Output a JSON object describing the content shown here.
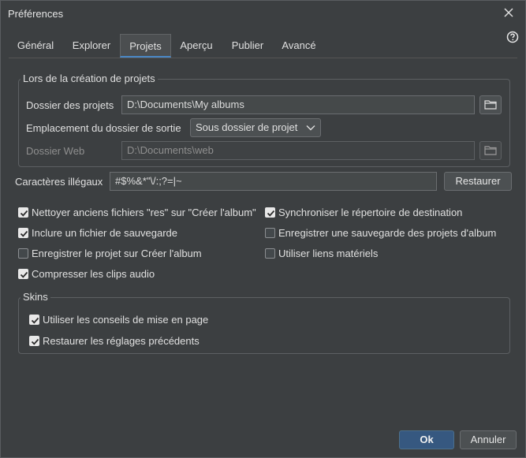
{
  "window": {
    "title": "Préférences"
  },
  "tabs": [
    {
      "label": "Général"
    },
    {
      "label": "Explorer"
    },
    {
      "label": "Projets"
    },
    {
      "label": "Aperçu"
    },
    {
      "label": "Publier"
    },
    {
      "label": "Avancé"
    }
  ],
  "creation": {
    "legend": "Lors de la création de projets",
    "project_folder_label": "Dossier des projets",
    "project_folder_value": "D:\\Documents\\My albums",
    "output_location_label": "Emplacement du dossier de sortie",
    "output_location_value": "Sous dossier de projet",
    "web_folder_label": "Dossier Web",
    "web_folder_value": "D:\\Documents\\web"
  },
  "illegal": {
    "label": "Caractères illégaux",
    "value": "#$%&*\"\\/:;?=|~",
    "restore_label": "Restaurer"
  },
  "options": [
    {
      "label": "Nettoyer anciens fichiers \"res\" sur \"Créer l'album\"",
      "checked": true
    },
    {
      "label": "Synchroniser le répertoire de destination",
      "checked": true
    },
    {
      "label": "Inclure un fichier de sauvegarde",
      "checked": true
    },
    {
      "label": "Enregistrer une sauvegarde des projets d'album",
      "checked": false
    },
    {
      "label": "Enregistrer le projet sur Créer l'album",
      "checked": false
    },
    {
      "label": "Utiliser liens matériels",
      "checked": false
    },
    {
      "label": "Compresser les clips audio",
      "checked": true
    }
  ],
  "skins": {
    "legend": "Skins",
    "options": [
      {
        "label": "Utiliser les conseils de mise en page",
        "checked": true
      },
      {
        "label": "Restaurer les réglages précédents",
        "checked": true
      }
    ]
  },
  "footer": {
    "ok_label": "Ok",
    "cancel_label": "Annuler"
  },
  "colors": {
    "accent": "#4a88c7",
    "primary_button": "#365880",
    "background": "#3c3f41"
  }
}
